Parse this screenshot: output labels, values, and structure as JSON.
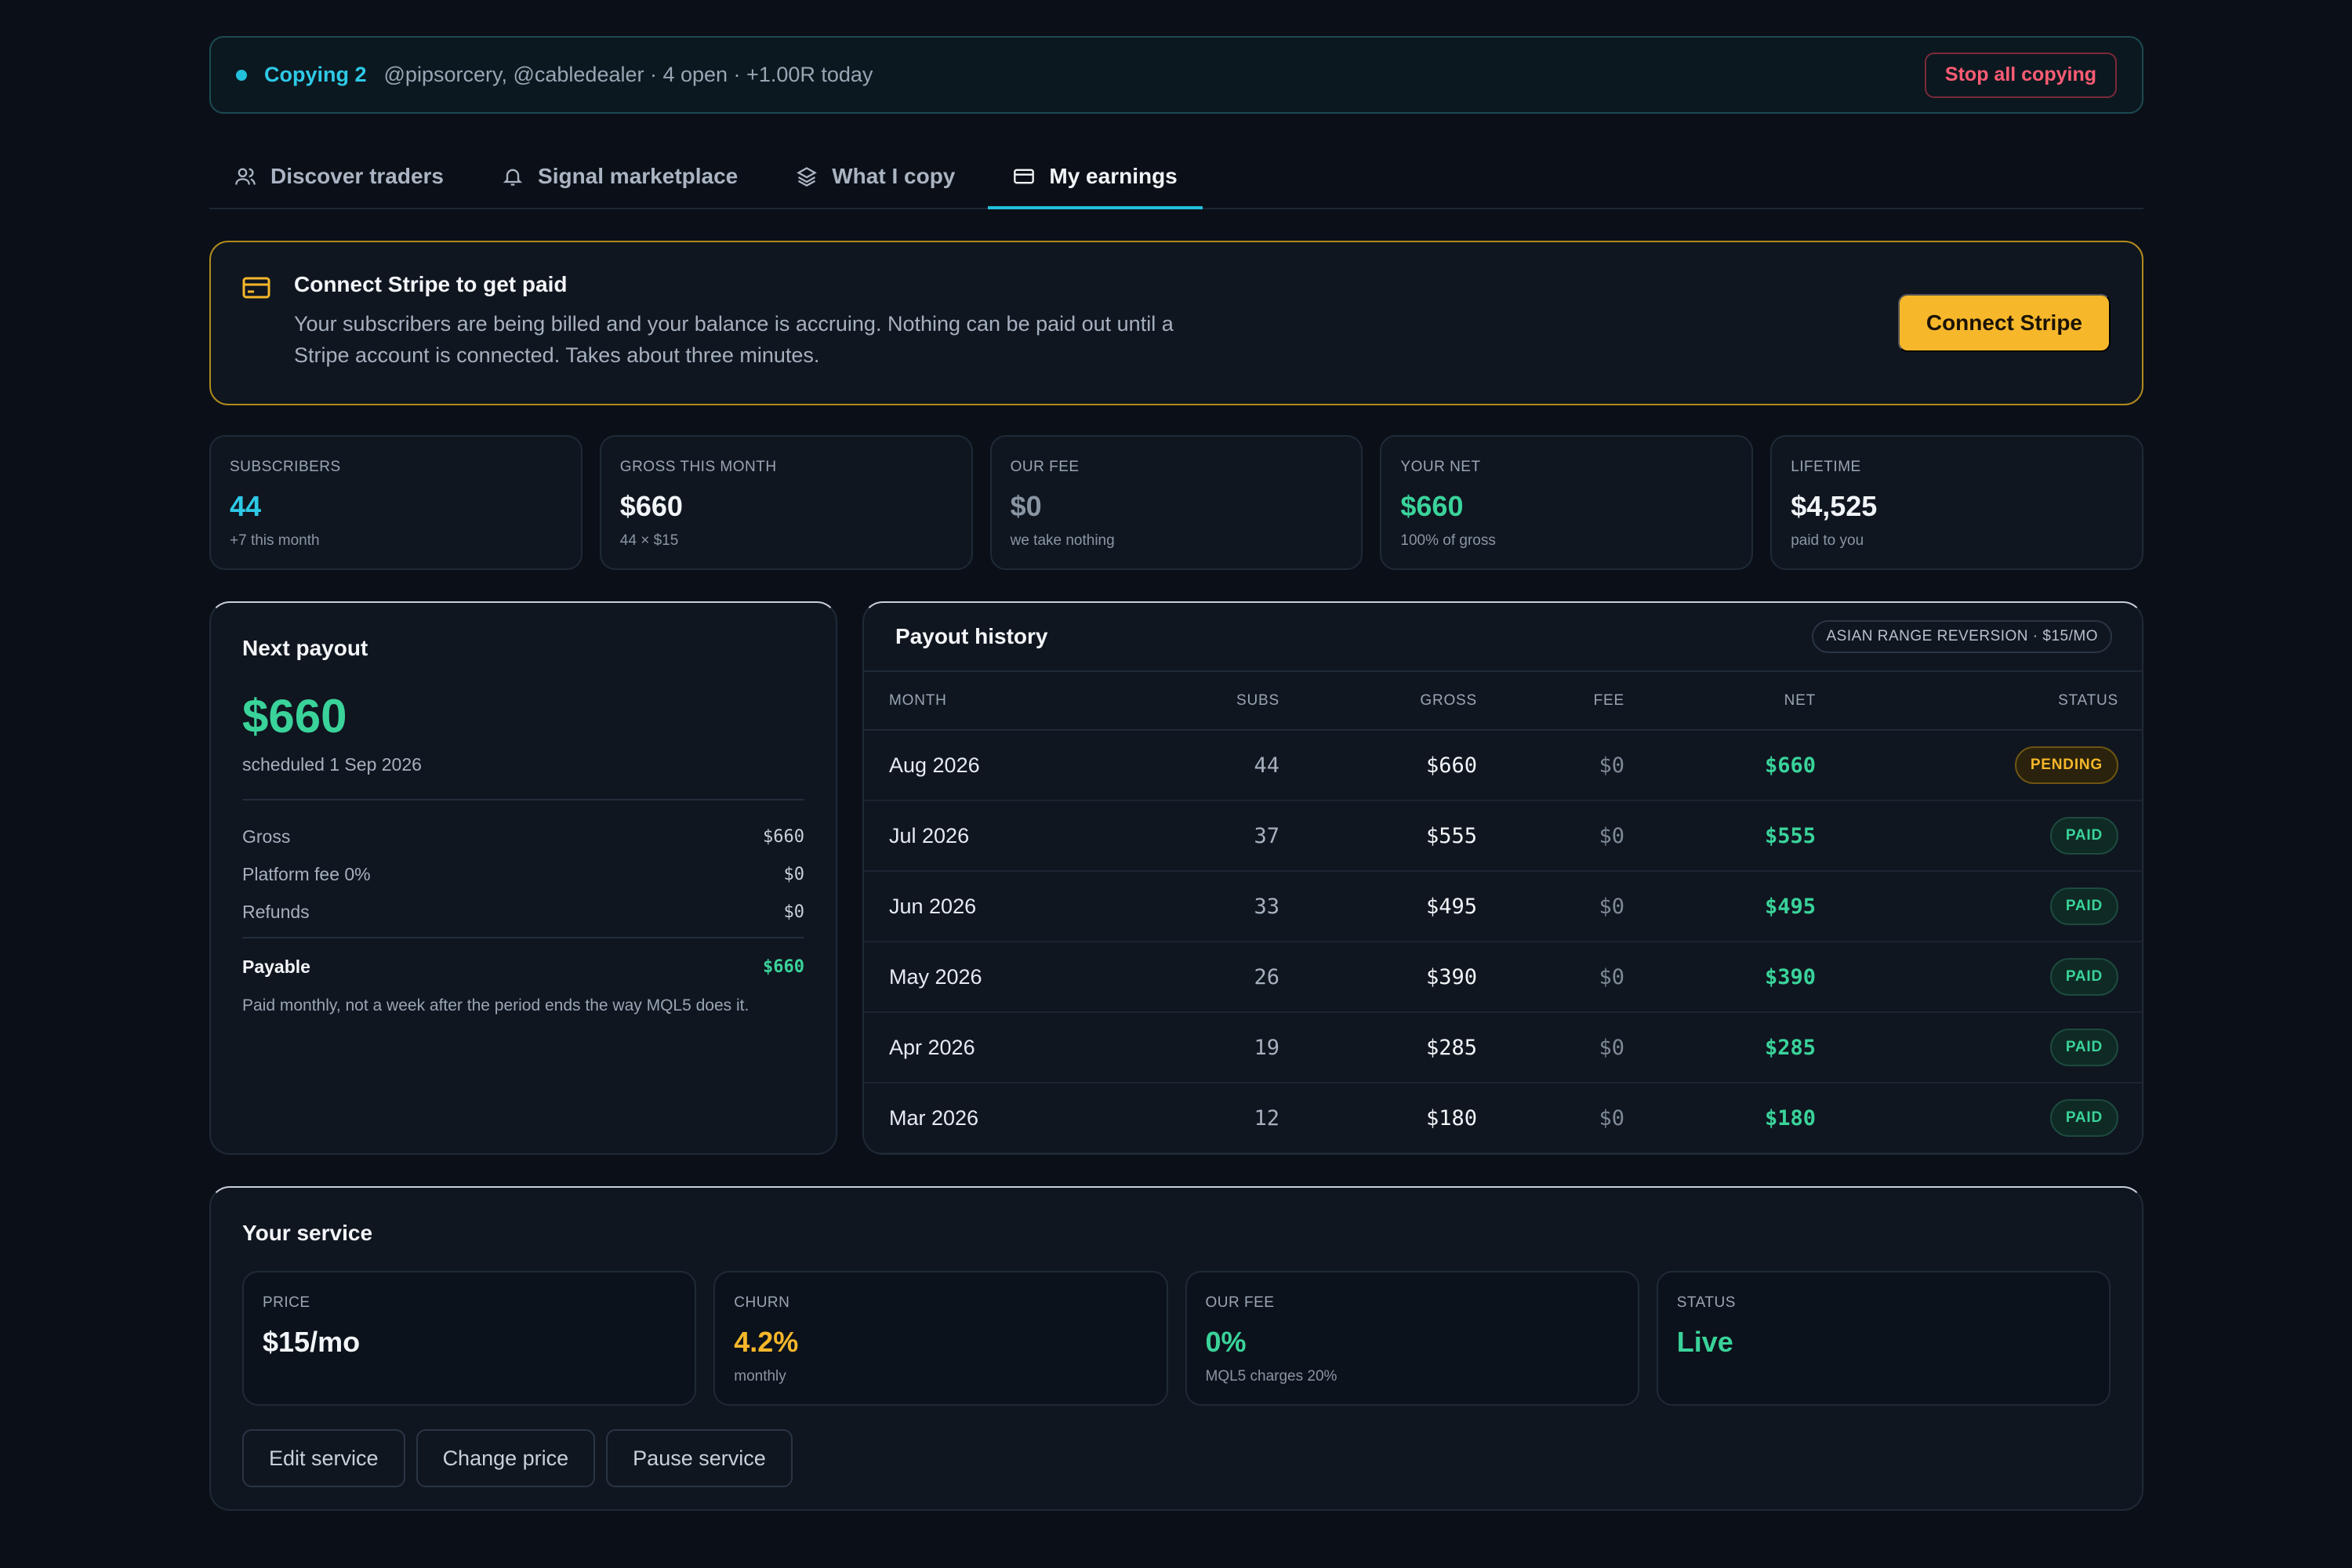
{
  "copy_bar": {
    "label": "Copying 2",
    "detail": "@pipsorcery, @cabledealer · 4 open · +1.00R today",
    "stop_label": "Stop all copying"
  },
  "tabs": [
    {
      "label": "Discover traders",
      "icon": "users-icon",
      "active": false
    },
    {
      "label": "Signal marketplace",
      "icon": "bell-icon",
      "active": false
    },
    {
      "label": "What I copy",
      "icon": "layers-icon",
      "active": false
    },
    {
      "label": "My earnings",
      "icon": "card-icon",
      "active": true
    }
  ],
  "stripe_banner": {
    "title": "Connect Stripe to get paid",
    "body": "Your subscribers are being billed and your balance is accruing. Nothing can be paid out until a Stripe account is connected. Takes about three minutes.",
    "button": "Connect Stripe"
  },
  "stats": [
    {
      "label": "SUBSCRIBERS",
      "value": "44",
      "sub": "+7 this month",
      "color": "#2ec9e6"
    },
    {
      "label": "GROSS THIS MONTH",
      "value": "$660",
      "sub": "44 × $15",
      "color": "#f2f5f8"
    },
    {
      "label": "OUR FEE",
      "value": "$0",
      "sub": "we take nothing",
      "color": "#8a95a4"
    },
    {
      "label": "YOUR NET",
      "value": "$660",
      "sub": "100% of gross",
      "color": "#3ad39a"
    },
    {
      "label": "LIFETIME",
      "value": "$4,525",
      "sub": "paid to you",
      "color": "#f2f5f8"
    }
  ],
  "next_payout": {
    "title": "Next payout",
    "amount": "$660",
    "scheduled": "scheduled 1 Sep 2026",
    "rows": [
      {
        "label": "Gross",
        "value": "$660"
      },
      {
        "label": "Platform fee 0%",
        "value": "$0"
      },
      {
        "label": "Refunds",
        "value": "$0"
      }
    ],
    "payable_label": "Payable",
    "payable_value": "$660",
    "note": "Paid monthly, not a week after the period ends the way MQL5 does it."
  },
  "payout_history": {
    "title": "Payout history",
    "pill": "ASIAN RANGE REVERSION · $15/MO",
    "columns": [
      "MONTH",
      "SUBS",
      "GROSS",
      "FEE",
      "NET",
      "STATUS"
    ],
    "rows": [
      {
        "month": "Aug 2026",
        "subs": "44",
        "gross": "$660",
        "fee": "$0",
        "net": "$660",
        "status": "PENDING"
      },
      {
        "month": "Jul 2026",
        "subs": "37",
        "gross": "$555",
        "fee": "$0",
        "net": "$555",
        "status": "PAID"
      },
      {
        "month": "Jun 2026",
        "subs": "33",
        "gross": "$495",
        "fee": "$0",
        "net": "$495",
        "status": "PAID"
      },
      {
        "month": "May 2026",
        "subs": "26",
        "gross": "$390",
        "fee": "$0",
        "net": "$390",
        "status": "PAID"
      },
      {
        "month": "Apr 2026",
        "subs": "19",
        "gross": "$285",
        "fee": "$0",
        "net": "$285",
        "status": "PAID"
      },
      {
        "month": "Mar 2026",
        "subs": "12",
        "gross": "$180",
        "fee": "$0",
        "net": "$180",
        "status": "PAID"
      }
    ]
  },
  "service": {
    "title": "Your service",
    "cards": [
      {
        "label": "PRICE",
        "value": "$15/mo",
        "sub": "",
        "color": "#f2f5f8"
      },
      {
        "label": "CHURN",
        "value": "4.2%",
        "sub": "monthly",
        "color": "#f6b72a"
      },
      {
        "label": "OUR FEE",
        "value": "0%",
        "sub": "MQL5 charges 20%",
        "color": "#3ad39a"
      },
      {
        "label": "STATUS",
        "value": "Live",
        "sub": "",
        "color": "#3ad39a"
      }
    ],
    "actions": [
      "Edit service",
      "Change price",
      "Pause service"
    ]
  }
}
